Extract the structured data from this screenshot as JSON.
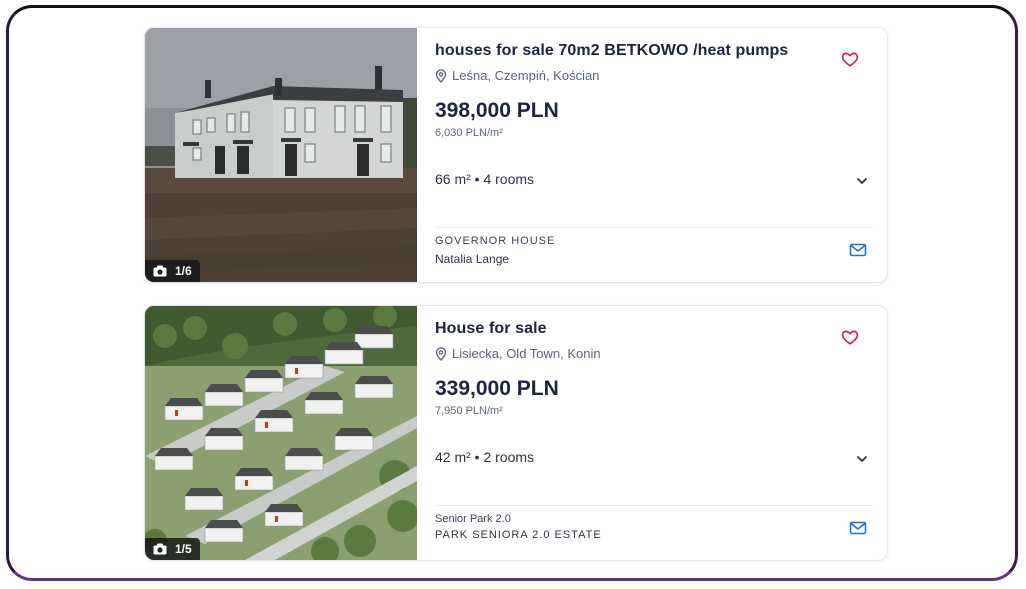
{
  "listings": [
    {
      "title": "houses for sale 70m2 BETKOWO /heat pumps",
      "location": "Leśna, Czempiń, Kościan",
      "price": "398,000 PLN",
      "price_per_m2": "6,030 PLN/m²",
      "specs": "66 m² • 4 rooms",
      "agency_line1": "GOVERNOR HOUSE",
      "agency_line2": "Natalia Lange",
      "photo_counter": "1/6"
    },
    {
      "title": "House for sale",
      "location": "Lisiecka, Old Town, Konin",
      "price": "339,000 PLN",
      "price_per_m2": "7,950 PLN/m²",
      "specs": "42 m² • 2 rooms",
      "agency_line1": "Senior Park 2.0",
      "agency_line2": "PARK SENIORA 2.0 ESTATE",
      "photo_counter": "1/5"
    }
  ],
  "icons": {
    "favorite": "heart-icon",
    "location": "location-pin-icon",
    "expand": "chevron-down-icon",
    "contact": "mail-icon",
    "photos": "camera-icon"
  },
  "colors": {
    "favorite": "#d6224f",
    "contact": "#1f6fd6",
    "text_primary": "#1c2440"
  }
}
